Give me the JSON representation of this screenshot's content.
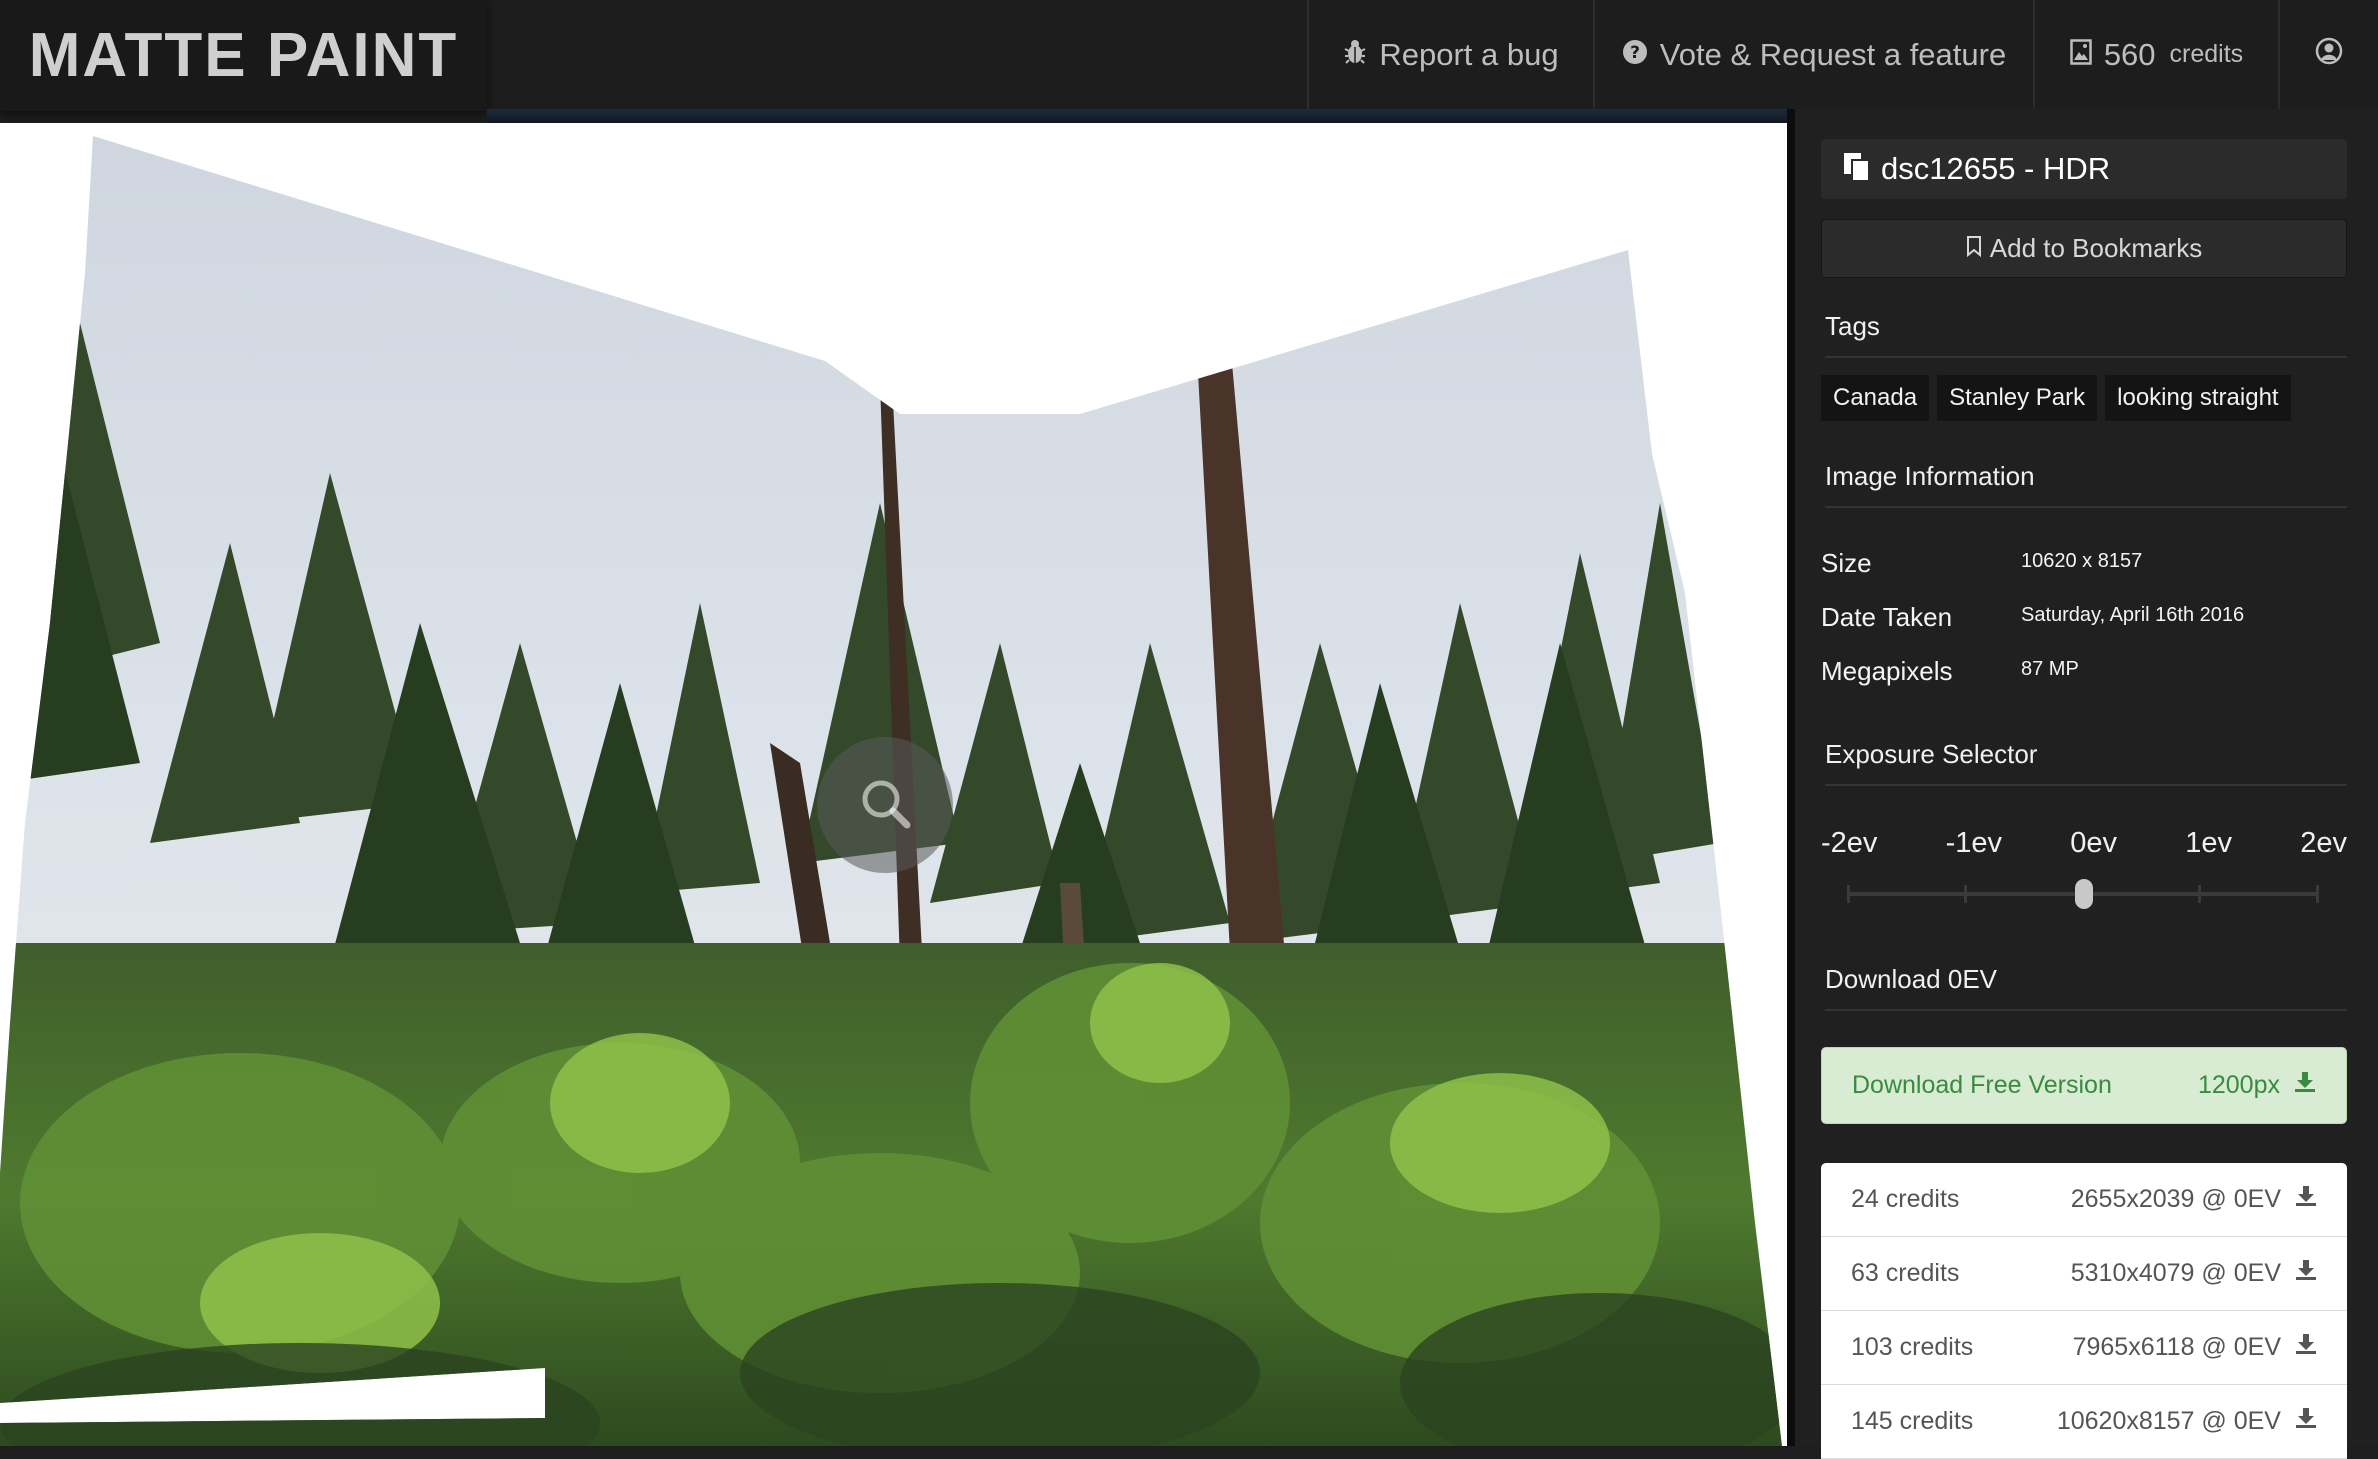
{
  "header": {
    "logo": "MATTE PAINT",
    "report_bug": "Report a bug",
    "vote_request": "Vote & Request a feature",
    "credits_count": "560",
    "credits_label": "credits"
  },
  "viewer": {
    "zoom_icon": "zoom-in-icon"
  },
  "sidebar": {
    "title": "dsc12655 - HDR",
    "bookmark_label": "Add to Bookmarks",
    "tags_heading": "Tags",
    "tags": [
      "Canada",
      "Stanley Park",
      "looking straight"
    ],
    "info_heading": "Image Information",
    "info": [
      {
        "label": "Size",
        "value": "10620 x 8157"
      },
      {
        "label": "Date Taken",
        "value": "Saturday, April 16th 2016"
      },
      {
        "label": "Megapixels",
        "value": "87 MP"
      }
    ],
    "exposure_heading": "Exposure Selector",
    "exposure_levels": [
      "-2ev",
      "-1ev",
      "0ev",
      "1ev",
      "2ev"
    ],
    "exposure_selected_index": 2,
    "download_heading": "Download 0EV",
    "free_download": {
      "label": "Download Free Version",
      "size": "1200px"
    },
    "downloads": [
      {
        "credits": "24 credits",
        "size": "2655x2039 @ 0EV"
      },
      {
        "credits": "63 credits",
        "size": "5310x4079 @ 0EV"
      },
      {
        "credits": "103 credits",
        "size": "7965x6118 @ 0EV"
      },
      {
        "credits": "145 credits",
        "size": "10620x8157 @ 0EV"
      }
    ]
  },
  "colors": {
    "navbar_bg": "#1d1d1d",
    "sidebar_bg": "#202020",
    "free_download_bg": "#d7ecd3",
    "free_download_text": "#3a8a3f"
  }
}
